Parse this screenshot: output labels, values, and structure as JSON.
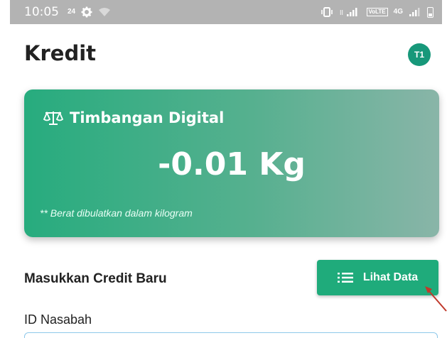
{
  "status_bar": {
    "time": "10:05",
    "notification_badge": "24",
    "volte_label": "VoLTE",
    "network_label": "4G",
    "icons": [
      "data-badge-icon",
      "gear-icon",
      "wifi-icon",
      "vibrate-icon",
      "signal-icon",
      "volte-icon",
      "signal-icon",
      "battery-icon"
    ]
  },
  "header": {
    "title": "Kredit",
    "avatar_initials": "T1"
  },
  "scale_card": {
    "icon": "scale-icon",
    "title": "Timbangan Digital",
    "weight": "-0.01 Kg",
    "note": "** Berat dibulatkan dalam kilogram"
  },
  "section": {
    "title": "Masukkan Credit Baru",
    "view_button_icon": "list-icon",
    "view_button_label": "Lihat Data",
    "id_field_label": "ID Nasabah"
  },
  "colors": {
    "primary": "#1fab7b",
    "avatar": "#17987a",
    "card_gradient_start": "#27ac7e",
    "card_gradient_end": "#89b5a8",
    "input_border": "#8ec8ea",
    "annotation_arrow": "#c0392b"
  }
}
